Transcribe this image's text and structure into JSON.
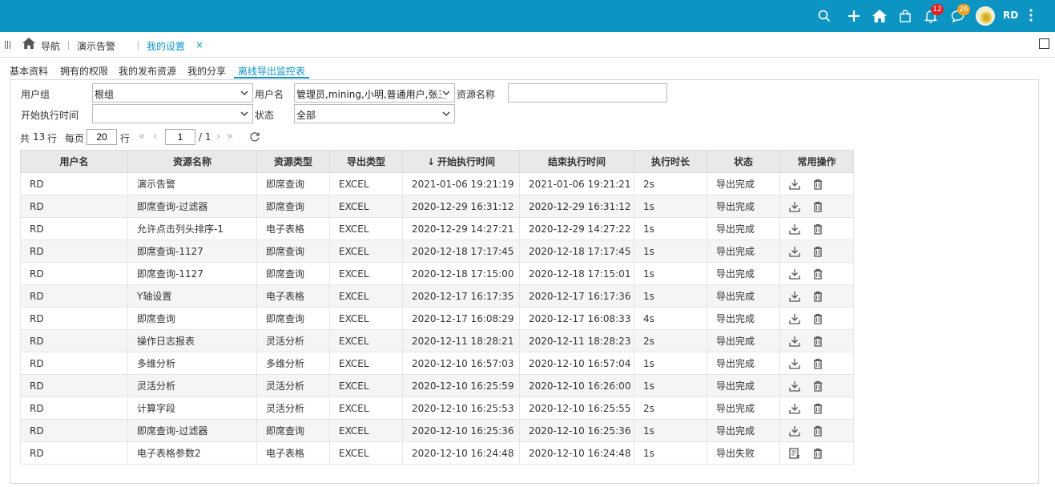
{
  "topbar": {
    "bell_badge": "12",
    "chat_badge": "26",
    "user": "RD",
    "bell_badge_color": "#e02020",
    "chat_badge_color": "#f0a020",
    "accent": "#0c95c3",
    "icons": [
      "search-icon",
      "plus-icon",
      "home-icon",
      "shop-bag-icon",
      "bell-icon",
      "chat-icon",
      "avatar",
      "more-icon"
    ]
  },
  "tabstrip": {
    "nav": "导航",
    "tab1": "演示告警",
    "tab2": "我的设置",
    "close": "×"
  },
  "subtabs": [
    "基本资料",
    "拥有的权限",
    "我的发布资源",
    "我的分享",
    "离线导出监控表"
  ],
  "filters": {
    "usergroup_label": "用户组",
    "usergroup_value": "根组",
    "username_label": "用户名",
    "username_value": "管理员,mining,小明,普通用户,张三",
    "resource_label": "资源名称",
    "resource_value": "",
    "start_label": "开始执行时间",
    "start_value": "",
    "status_label": "状态",
    "status_value": "全部"
  },
  "pager": {
    "total_prefix": "共",
    "total": "13",
    "total_suffix": "行",
    "per_label": "每页",
    "per_value": "20",
    "per_suffix": "行",
    "page": "1",
    "of": "/ 1",
    "nav_icons": [
      "first-page-icon",
      "prev-page-icon",
      "next-page-icon",
      "last-page-icon",
      "refresh-icon"
    ]
  },
  "table": {
    "headers": [
      "用户名",
      "资源名称",
      "资源类型",
      "导出类型",
      "开始执行时间",
      "结束执行时间",
      "执行时长",
      "状态",
      "常用操作"
    ],
    "sort_indicator": "↓",
    "rows": [
      [
        "RD",
        "演示告警",
        "即席查询",
        "EXCEL",
        "2021-01-06 19:21:19",
        "2021-01-06 19:21:21",
        "2s",
        "导出完成"
      ],
      [
        "RD",
        "即席查询-过滤器",
        "即席查询",
        "EXCEL",
        "2020-12-29 16:31:12",
        "2020-12-29 16:31:12",
        "1s",
        "导出完成"
      ],
      [
        "RD",
        "允许点击列头排序-1",
        "电子表格",
        "EXCEL",
        "2020-12-29 14:27:21",
        "2020-12-29 14:27:22",
        "1s",
        "导出完成"
      ],
      [
        "RD",
        "即席查询-1127",
        "即席查询",
        "EXCEL",
        "2020-12-18 17:17:45",
        "2020-12-18 17:17:45",
        "1s",
        "导出完成"
      ],
      [
        "RD",
        "即席查询-1127",
        "即席查询",
        "EXCEL",
        "2020-12-18 17:15:00",
        "2020-12-18 17:15:01",
        "1s",
        "导出完成"
      ],
      [
        "RD",
        "Y轴设置",
        "电子表格",
        "EXCEL",
        "2020-12-17 16:17:35",
        "2020-12-17 16:17:36",
        "1s",
        "导出完成"
      ],
      [
        "RD",
        "即席查询",
        "即席查询",
        "EXCEL",
        "2020-12-17 16:08:29",
        "2020-12-17 16:08:33",
        "4s",
        "导出完成"
      ],
      [
        "RD",
        "操作日志报表",
        "灵活分析",
        "EXCEL",
        "2020-12-11 18:28:21",
        "2020-12-11 18:28:23",
        "2s",
        "导出完成"
      ],
      [
        "RD",
        "多维分析",
        "多维分析",
        "EXCEL",
        "2020-12-10 16:57:03",
        "2020-12-10 16:57:04",
        "1s",
        "导出完成"
      ],
      [
        "RD",
        "灵活分析",
        "灵活分析",
        "EXCEL",
        "2020-12-10 16:25:59",
        "2020-12-10 16:26:00",
        "1s",
        "导出完成"
      ],
      [
        "RD",
        "计算字段",
        "灵活分析",
        "EXCEL",
        "2020-12-10 16:25:53",
        "2020-12-10 16:25:55",
        "2s",
        "导出完成"
      ],
      [
        "RD",
        "即席查询-过滤器",
        "即席查询",
        "EXCEL",
        "2020-12-10 16:25:36",
        "2020-12-10 16:25:36",
        "1s",
        "导出完成"
      ],
      [
        "RD",
        "电子表格参数2",
        "电子表格",
        "EXCEL",
        "2020-12-10 16:24:48",
        "2020-12-10 16:24:48",
        "1s",
        "导出失败"
      ]
    ],
    "row_ops": [
      [
        "download-icon",
        "delete-icon"
      ],
      [
        "download-icon",
        "delete-icon"
      ],
      [
        "download-icon",
        "delete-icon"
      ],
      [
        "download-icon",
        "delete-icon"
      ],
      [
        "download-icon",
        "delete-icon"
      ],
      [
        "download-icon",
        "delete-icon"
      ],
      [
        "download-icon",
        "delete-icon"
      ],
      [
        "download-icon",
        "delete-icon"
      ],
      [
        "download-icon",
        "delete-icon"
      ],
      [
        "download-icon",
        "delete-icon"
      ],
      [
        "download-icon",
        "delete-icon"
      ],
      [
        "download-icon",
        "delete-icon"
      ],
      [
        "log-icon",
        "delete-icon"
      ]
    ]
  }
}
